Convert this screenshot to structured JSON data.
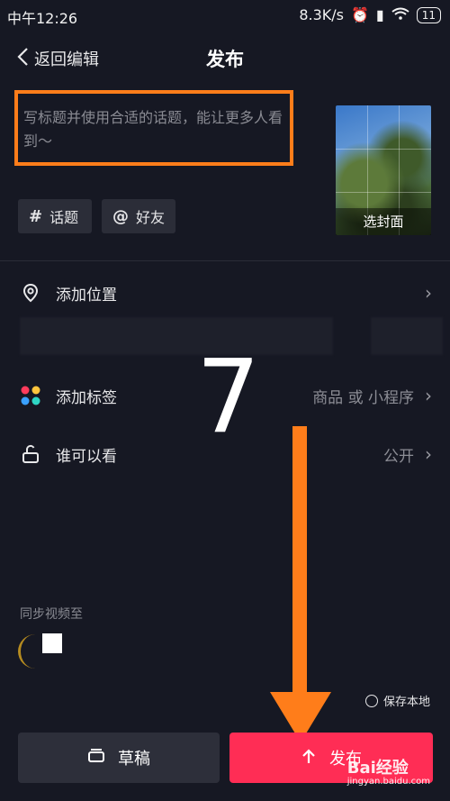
{
  "status_bar": {
    "time": "中午12:26",
    "speed": "8.3K/s",
    "battery": "11"
  },
  "header": {
    "back_label": "返回编辑",
    "title": "发布"
  },
  "caption": {
    "placeholder": "写标题并使用合适的话题，能让更多人看到～"
  },
  "cover": {
    "label": "选封面"
  },
  "chips": {
    "topic": "话题",
    "topic_symbol": "#",
    "friends": "好友",
    "friends_symbol": "@"
  },
  "rows": {
    "location": {
      "label": "添加位置"
    },
    "tags": {
      "label": "添加标签",
      "value": "商品 或 小程序"
    },
    "visibility": {
      "label": "谁可以看",
      "value": "公开"
    }
  },
  "overlay_number": "7",
  "sync": {
    "label": "同步视频至"
  },
  "save_local": {
    "label": "保存本地"
  },
  "buttons": {
    "draft": "草稿",
    "publish": "发布"
  },
  "watermark": {
    "brand": "Bai经验",
    "url": "jingyan.baidu.com"
  },
  "colors": {
    "background": "#161823",
    "publish": "#ff2d55",
    "annotation": "#ff7d1a"
  }
}
